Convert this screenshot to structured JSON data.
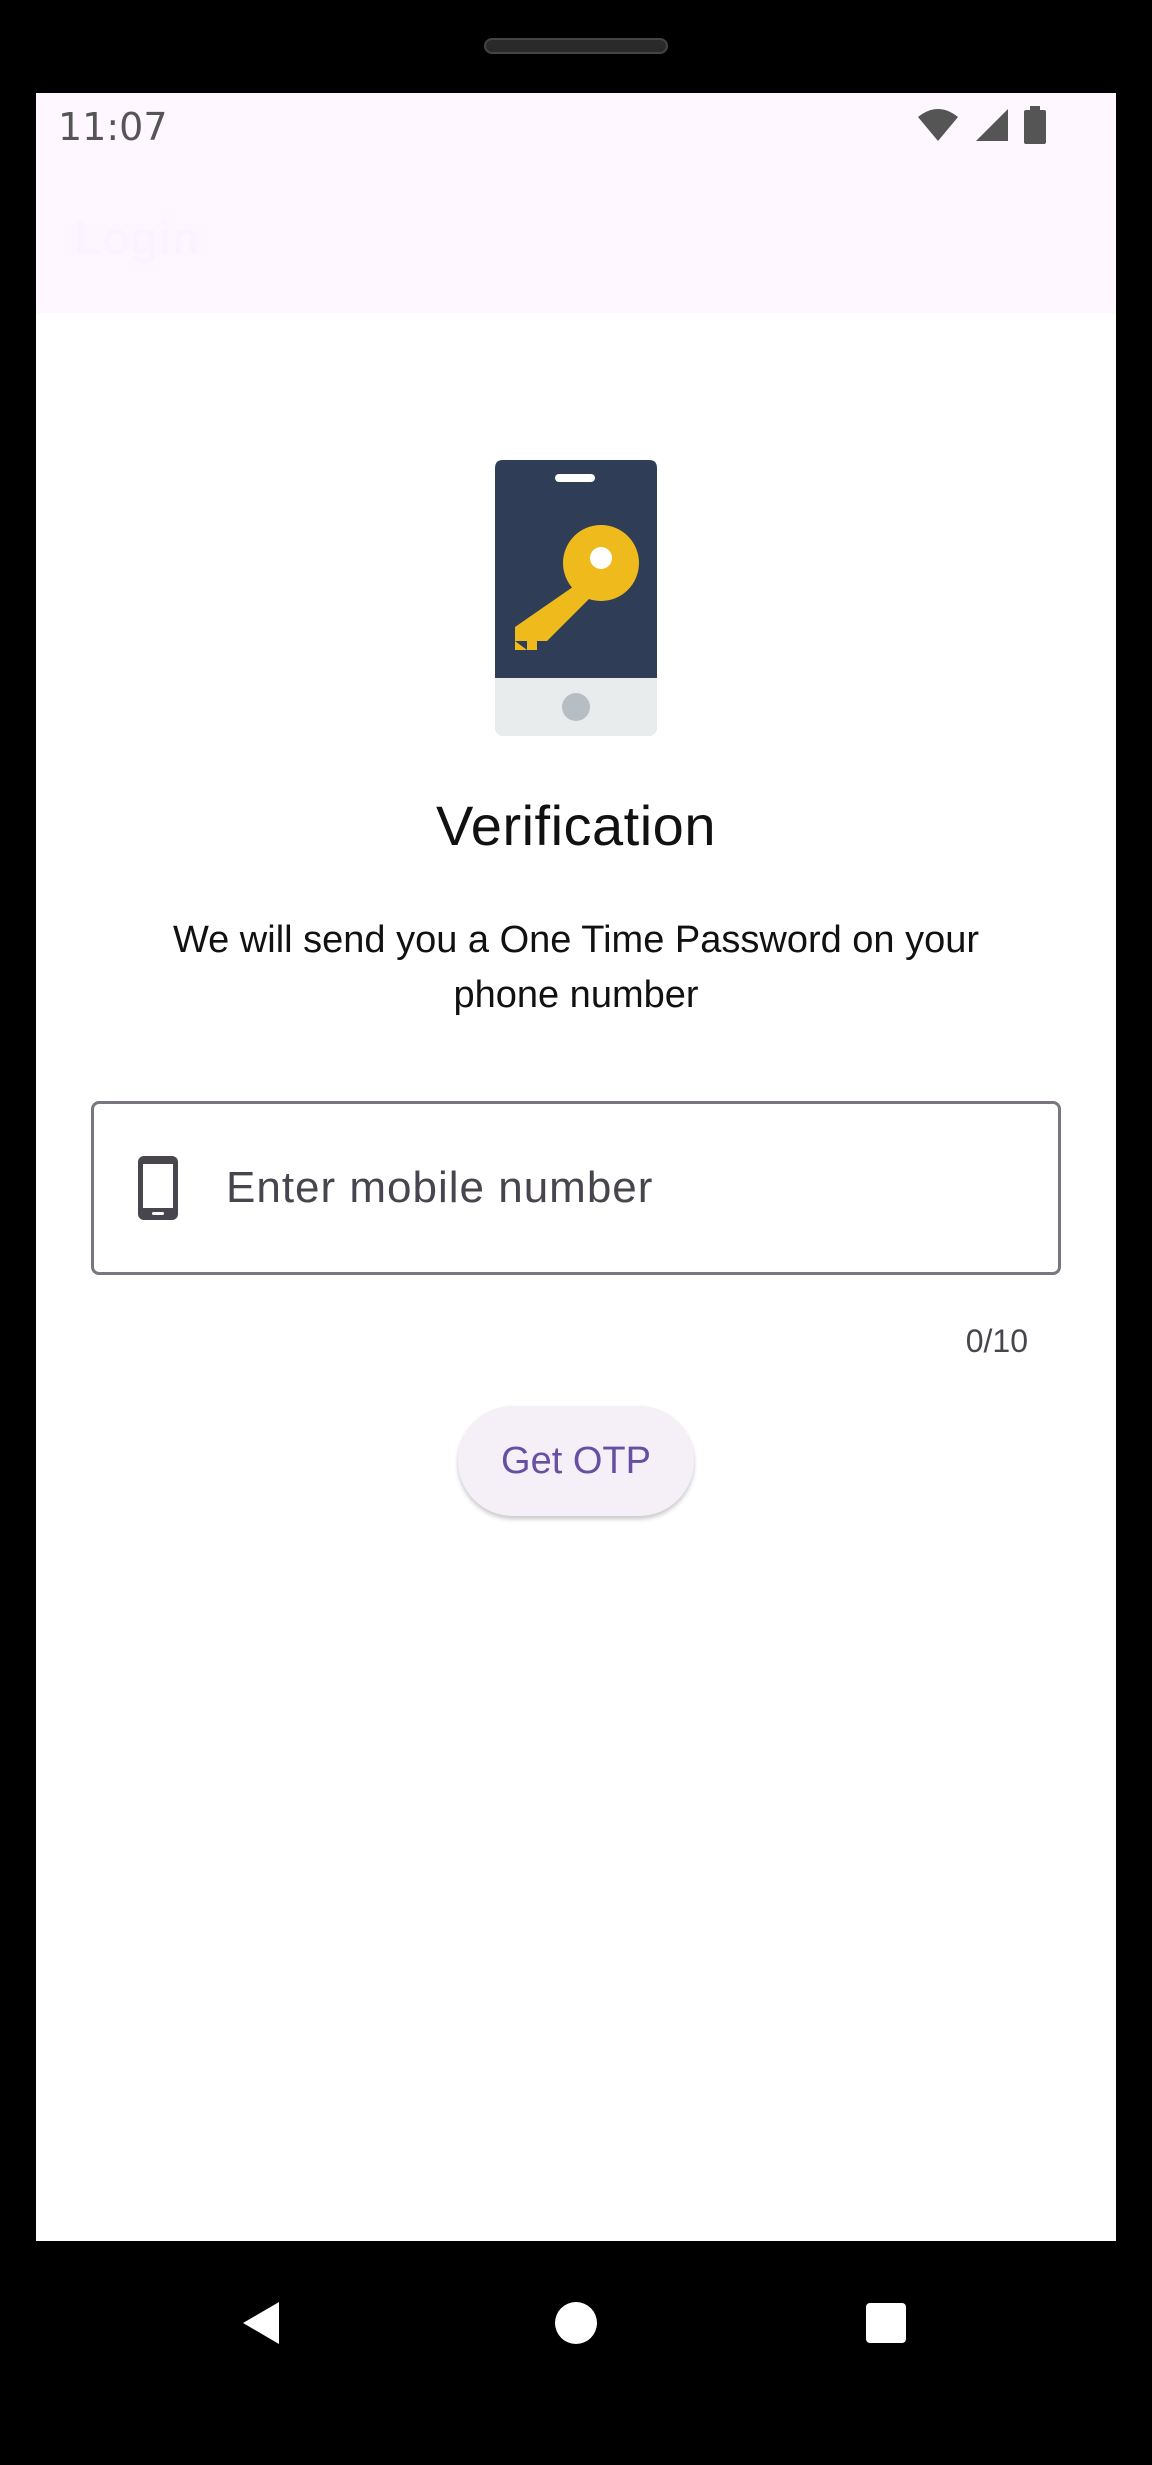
{
  "status_bar": {
    "time": "11:07",
    "icons": [
      "wifi-icon",
      "signal-icon",
      "battery-icon"
    ]
  },
  "app_bar": {
    "title": "Login"
  },
  "illustration": {
    "icon": "phone-key-icon"
  },
  "main": {
    "title": "Verification",
    "subtitle": "We will send you a One Time Password on your phone number",
    "input": {
      "placeholder": "Enter mobile number",
      "value": "",
      "icon": "smartphone-icon",
      "counter": "0/10"
    },
    "button_label": "Get OTP"
  },
  "nav_bar": {
    "back": "back-icon",
    "home": "home-icon",
    "recents": "recents-icon"
  },
  "colors": {
    "accent": "#6750a4",
    "appbar_bg": "#fef7ff",
    "phone_body": "#2f3e56",
    "key": "#efbb1c"
  }
}
